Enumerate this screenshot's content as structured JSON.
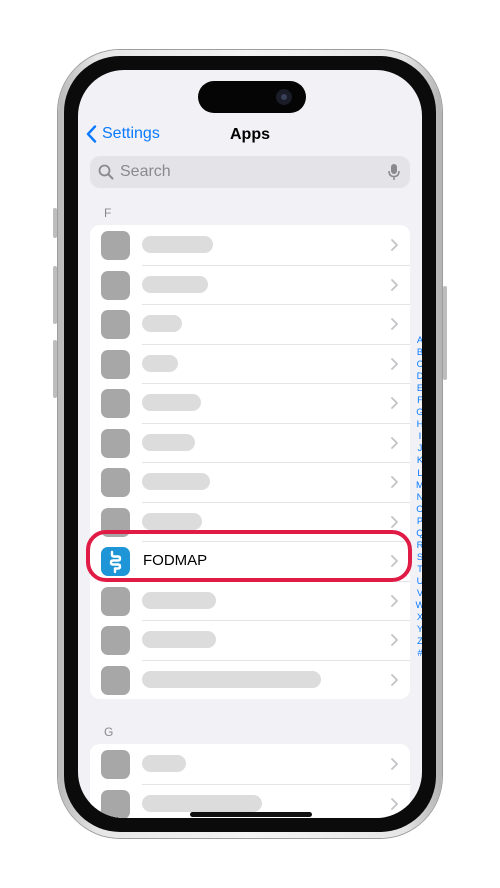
{
  "nav": {
    "back_label": "Settings",
    "title": "Apps"
  },
  "search": {
    "placeholder": "Search"
  },
  "sections": [
    {
      "header": "F",
      "rows_visible": 12
    },
    {
      "header": "G",
      "rows_visible": 2
    }
  ],
  "highlighted_app": {
    "name": "FODMAP",
    "icon": "fodmap-intestine-icon"
  },
  "index_letters": [
    "A",
    "B",
    "C",
    "D",
    "E",
    "F",
    "G",
    "H",
    "I",
    "J",
    "K",
    "L",
    "M",
    "N",
    "O",
    "P",
    "Q",
    "R",
    "S",
    "T",
    "U",
    "V",
    "W",
    "X",
    "Y",
    "Z",
    "#"
  ],
  "colors": {
    "accent": "#0a7aff",
    "highlight": "#e01b45",
    "app_icon": "#1e95d6"
  }
}
